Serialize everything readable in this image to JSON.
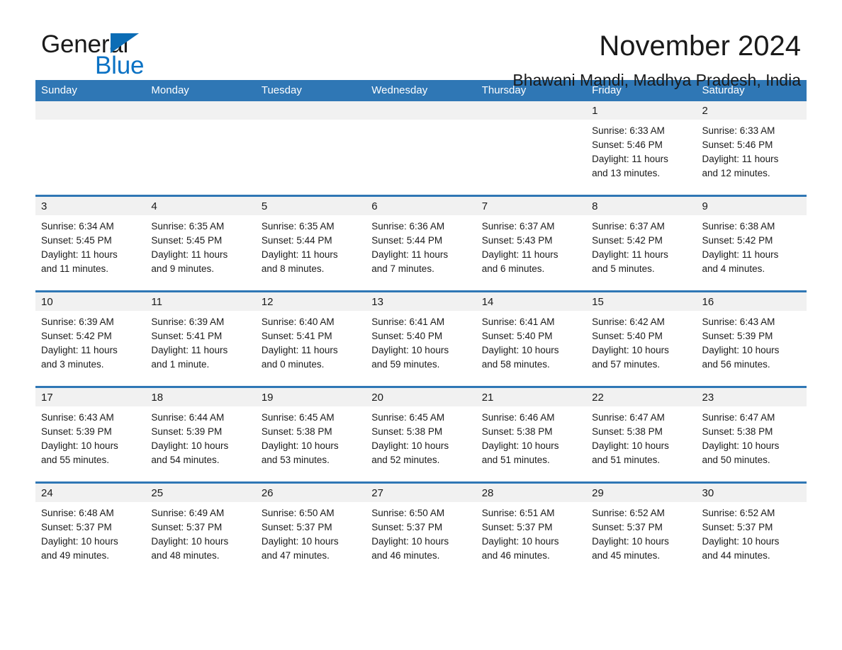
{
  "brand": {
    "name_part1": "General",
    "name_part2": "Blue",
    "accent_color": "#0b72c4",
    "triangle_color": "#0b6cb5"
  },
  "header": {
    "title": "November 2024",
    "subtitle": "Bhawani Mandi, Madhya Pradesh, India"
  },
  "calendar": {
    "header_bg": "#2f77b5",
    "date_band_bg": "#f1f1f1",
    "weekdays": [
      "Sunday",
      "Monday",
      "Tuesday",
      "Wednesday",
      "Thursday",
      "Friday",
      "Saturday"
    ],
    "labels": {
      "sunrise": "Sunrise:",
      "sunset": "Sunset:",
      "daylight": "Daylight:"
    },
    "weeks": [
      [
        {
          "date": "",
          "empty": true
        },
        {
          "date": "",
          "empty": true
        },
        {
          "date": "",
          "empty": true
        },
        {
          "date": "",
          "empty": true
        },
        {
          "date": "",
          "empty": true
        },
        {
          "date": "1",
          "sunrise": "Sunrise: 6:33 AM",
          "sunset": "Sunset: 5:46 PM",
          "daylight_1": "Daylight: 11 hours",
          "daylight_2": "and 13 minutes."
        },
        {
          "date": "2",
          "sunrise": "Sunrise: 6:33 AM",
          "sunset": "Sunset: 5:46 PM",
          "daylight_1": "Daylight: 11 hours",
          "daylight_2": "and 12 minutes."
        }
      ],
      [
        {
          "date": "3",
          "sunrise": "Sunrise: 6:34 AM",
          "sunset": "Sunset: 5:45 PM",
          "daylight_1": "Daylight: 11 hours",
          "daylight_2": "and 11 minutes."
        },
        {
          "date": "4",
          "sunrise": "Sunrise: 6:35 AM",
          "sunset": "Sunset: 5:45 PM",
          "daylight_1": "Daylight: 11 hours",
          "daylight_2": "and 9 minutes."
        },
        {
          "date": "5",
          "sunrise": "Sunrise: 6:35 AM",
          "sunset": "Sunset: 5:44 PM",
          "daylight_1": "Daylight: 11 hours",
          "daylight_2": "and 8 minutes."
        },
        {
          "date": "6",
          "sunrise": "Sunrise: 6:36 AM",
          "sunset": "Sunset: 5:44 PM",
          "daylight_1": "Daylight: 11 hours",
          "daylight_2": "and 7 minutes."
        },
        {
          "date": "7",
          "sunrise": "Sunrise: 6:37 AM",
          "sunset": "Sunset: 5:43 PM",
          "daylight_1": "Daylight: 11 hours",
          "daylight_2": "and 6 minutes."
        },
        {
          "date": "8",
          "sunrise": "Sunrise: 6:37 AM",
          "sunset": "Sunset: 5:42 PM",
          "daylight_1": "Daylight: 11 hours",
          "daylight_2": "and 5 minutes."
        },
        {
          "date": "9",
          "sunrise": "Sunrise: 6:38 AM",
          "sunset": "Sunset: 5:42 PM",
          "daylight_1": "Daylight: 11 hours",
          "daylight_2": "and 4 minutes."
        }
      ],
      [
        {
          "date": "10",
          "sunrise": "Sunrise: 6:39 AM",
          "sunset": "Sunset: 5:42 PM",
          "daylight_1": "Daylight: 11 hours",
          "daylight_2": "and 3 minutes."
        },
        {
          "date": "11",
          "sunrise": "Sunrise: 6:39 AM",
          "sunset": "Sunset: 5:41 PM",
          "daylight_1": "Daylight: 11 hours",
          "daylight_2": "and 1 minute."
        },
        {
          "date": "12",
          "sunrise": "Sunrise: 6:40 AM",
          "sunset": "Sunset: 5:41 PM",
          "daylight_1": "Daylight: 11 hours",
          "daylight_2": "and 0 minutes."
        },
        {
          "date": "13",
          "sunrise": "Sunrise: 6:41 AM",
          "sunset": "Sunset: 5:40 PM",
          "daylight_1": "Daylight: 10 hours",
          "daylight_2": "and 59 minutes."
        },
        {
          "date": "14",
          "sunrise": "Sunrise: 6:41 AM",
          "sunset": "Sunset: 5:40 PM",
          "daylight_1": "Daylight: 10 hours",
          "daylight_2": "and 58 minutes."
        },
        {
          "date": "15",
          "sunrise": "Sunrise: 6:42 AM",
          "sunset": "Sunset: 5:40 PM",
          "daylight_1": "Daylight: 10 hours",
          "daylight_2": "and 57 minutes."
        },
        {
          "date": "16",
          "sunrise": "Sunrise: 6:43 AM",
          "sunset": "Sunset: 5:39 PM",
          "daylight_1": "Daylight: 10 hours",
          "daylight_2": "and 56 minutes."
        }
      ],
      [
        {
          "date": "17",
          "sunrise": "Sunrise: 6:43 AM",
          "sunset": "Sunset: 5:39 PM",
          "daylight_1": "Daylight: 10 hours",
          "daylight_2": "and 55 minutes."
        },
        {
          "date": "18",
          "sunrise": "Sunrise: 6:44 AM",
          "sunset": "Sunset: 5:39 PM",
          "daylight_1": "Daylight: 10 hours",
          "daylight_2": "and 54 minutes."
        },
        {
          "date": "19",
          "sunrise": "Sunrise: 6:45 AM",
          "sunset": "Sunset: 5:38 PM",
          "daylight_1": "Daylight: 10 hours",
          "daylight_2": "and 53 minutes."
        },
        {
          "date": "20",
          "sunrise": "Sunrise: 6:45 AM",
          "sunset": "Sunset: 5:38 PM",
          "daylight_1": "Daylight: 10 hours",
          "daylight_2": "and 52 minutes."
        },
        {
          "date": "21",
          "sunrise": "Sunrise: 6:46 AM",
          "sunset": "Sunset: 5:38 PM",
          "daylight_1": "Daylight: 10 hours",
          "daylight_2": "and 51 minutes."
        },
        {
          "date": "22",
          "sunrise": "Sunrise: 6:47 AM",
          "sunset": "Sunset: 5:38 PM",
          "daylight_1": "Daylight: 10 hours",
          "daylight_2": "and 51 minutes."
        },
        {
          "date": "23",
          "sunrise": "Sunrise: 6:47 AM",
          "sunset": "Sunset: 5:38 PM",
          "daylight_1": "Daylight: 10 hours",
          "daylight_2": "and 50 minutes."
        }
      ],
      [
        {
          "date": "24",
          "sunrise": "Sunrise: 6:48 AM",
          "sunset": "Sunset: 5:37 PM",
          "daylight_1": "Daylight: 10 hours",
          "daylight_2": "and 49 minutes."
        },
        {
          "date": "25",
          "sunrise": "Sunrise: 6:49 AM",
          "sunset": "Sunset: 5:37 PM",
          "daylight_1": "Daylight: 10 hours",
          "daylight_2": "and 48 minutes."
        },
        {
          "date": "26",
          "sunrise": "Sunrise: 6:50 AM",
          "sunset": "Sunset: 5:37 PM",
          "daylight_1": "Daylight: 10 hours",
          "daylight_2": "and 47 minutes."
        },
        {
          "date": "27",
          "sunrise": "Sunrise: 6:50 AM",
          "sunset": "Sunset: 5:37 PM",
          "daylight_1": "Daylight: 10 hours",
          "daylight_2": "and 46 minutes."
        },
        {
          "date": "28",
          "sunrise": "Sunrise: 6:51 AM",
          "sunset": "Sunset: 5:37 PM",
          "daylight_1": "Daylight: 10 hours",
          "daylight_2": "and 46 minutes."
        },
        {
          "date": "29",
          "sunrise": "Sunrise: 6:52 AM",
          "sunset": "Sunset: 5:37 PM",
          "daylight_1": "Daylight: 10 hours",
          "daylight_2": "and 45 minutes."
        },
        {
          "date": "30",
          "sunrise": "Sunrise: 6:52 AM",
          "sunset": "Sunset: 5:37 PM",
          "daylight_1": "Daylight: 10 hours",
          "daylight_2": "and 44 minutes."
        }
      ]
    ]
  }
}
